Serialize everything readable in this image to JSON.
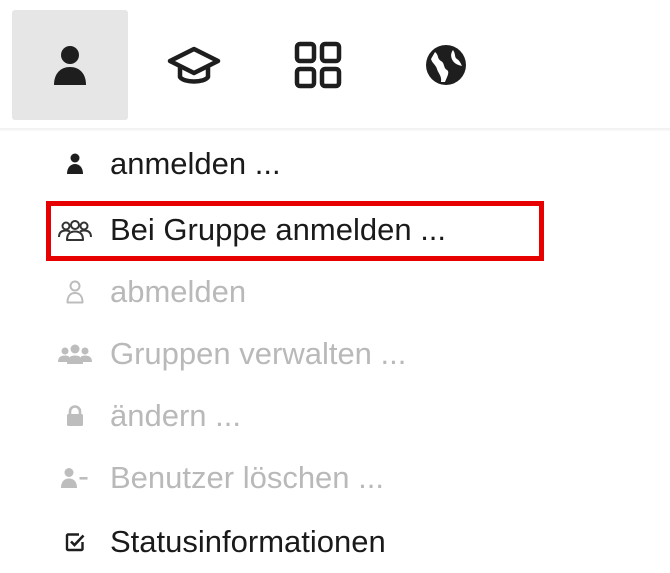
{
  "toolbar": {
    "buttons": [
      {
        "icon": "user-icon",
        "active": true
      },
      {
        "icon": "graduation-cap-icon",
        "active": false
      },
      {
        "icon": "apps-grid-icon",
        "active": false
      },
      {
        "icon": "globe-icon",
        "active": false
      }
    ]
  },
  "menu": {
    "items": [
      {
        "label": "anmelden ...",
        "icon": "user-icon",
        "enabled": true
      },
      {
        "label": "Bei Gruppe anmelden ...",
        "icon": "group-icon",
        "enabled": true,
        "highlighted": true
      },
      {
        "label": "abmelden",
        "icon": "user-outline-icon",
        "enabled": false
      },
      {
        "label": "Gruppen verwalten ...",
        "icon": "group-filled-icon",
        "enabled": false
      },
      {
        "label": "ändern ...",
        "icon": "lock-icon",
        "enabled": false
      },
      {
        "label": "Benutzer löschen ...",
        "icon": "user-minus-icon",
        "enabled": false
      },
      {
        "label": "Statusinformationen",
        "icon": "checkbox-icon",
        "enabled": true
      }
    ]
  },
  "colors": {
    "highlight_border": "#e60000",
    "active_button_bg": "#e6e6e6",
    "enabled_text": "#1a1a1a",
    "disabled_text": "#b9b9b9"
  }
}
